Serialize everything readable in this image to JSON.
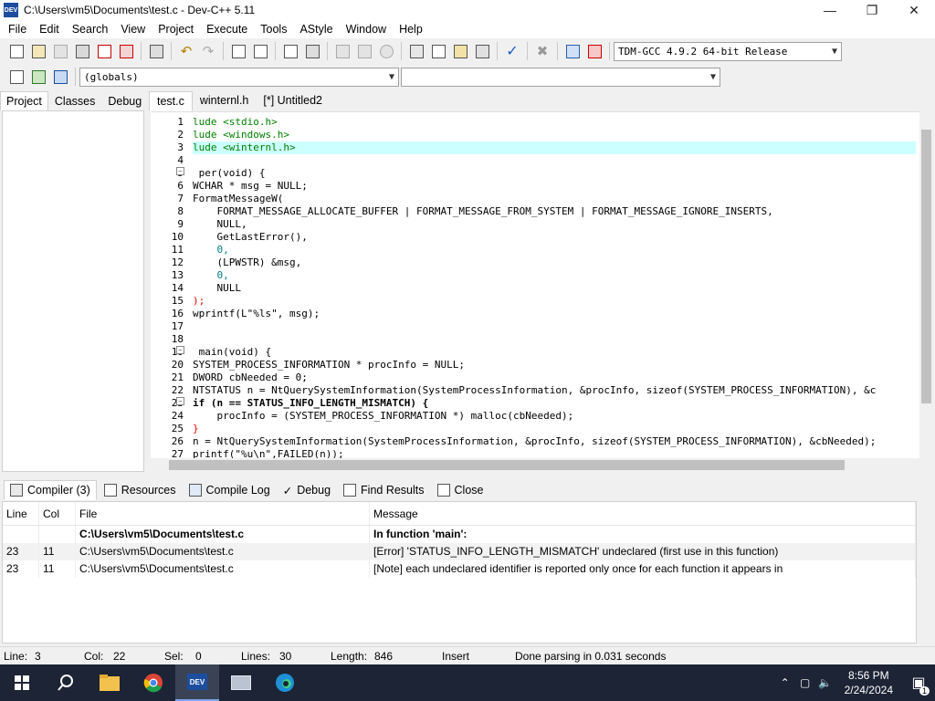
{
  "window": {
    "title": "C:\\Users\\vm5\\Documents\\test.c - Dev-C++ 5.11",
    "app_icon": "DEV"
  },
  "menu": [
    "File",
    "Edit",
    "Search",
    "View",
    "Project",
    "Execute",
    "Tools",
    "AStyle",
    "Window",
    "Help"
  ],
  "toolbar": {
    "compiler": "TDM-GCC 4.9.2 64-bit Release",
    "scope": "(globals)",
    "member": ""
  },
  "left_tabs": [
    "Project",
    "Classes",
    "Debug"
  ],
  "editor_tabs": [
    "test.c",
    "winternl.h",
    "[*] Untitled2"
  ],
  "code_lines": [
    {
      "n": "1",
      "t": "lude <stdio.h>"
    },
    {
      "n": "2",
      "t": "lude <windows.h>"
    },
    {
      "n": "3",
      "t": "lude <winternl.h>"
    },
    {
      "n": "4",
      "t": ""
    },
    {
      "n": "5",
      "t": " per(void) {"
    },
    {
      "n": "6",
      "t": "WCHAR * msg = NULL;"
    },
    {
      "n": "7",
      "t": "FormatMessageW("
    },
    {
      "n": "8",
      "t": "    FORMAT_MESSAGE_ALLOCATE_BUFFER | FORMAT_MESSAGE_FROM_SYSTEM | FORMAT_MESSAGE_IGNORE_INSERTS,"
    },
    {
      "n": "9",
      "t": "    NULL,"
    },
    {
      "n": "10",
      "t": "    GetLastError(),"
    },
    {
      "n": "11",
      "t": "    0,"
    },
    {
      "n": "12",
      "t": "    (LPWSTR) &msg,"
    },
    {
      "n": "13",
      "t": "    0,"
    },
    {
      "n": "14",
      "t": "    NULL"
    },
    {
      "n": "15",
      "t": ");"
    },
    {
      "n": "16",
      "t": "wprintf(L\"%ls\", msg);"
    },
    {
      "n": "17",
      "t": ""
    },
    {
      "n": "18",
      "t": ""
    },
    {
      "n": "19",
      "t": " main(void) {"
    },
    {
      "n": "20",
      "t": "SYSTEM_PROCESS_INFORMATION * procInfo = NULL;"
    },
    {
      "n": "21",
      "t": "DWORD cbNeeded = 0;"
    },
    {
      "n": "22",
      "t": "NTSTATUS n = NtQuerySystemInformation(SystemProcessInformation, &procInfo, sizeof(SYSTEM_PROCESS_INFORMATION), &c"
    },
    {
      "n": "23",
      "t": "if (n == STATUS_INFO_LENGTH_MISMATCH) {"
    },
    {
      "n": "24",
      "t": "    procInfo = (SYSTEM_PROCESS_INFORMATION *) malloc(cbNeeded);"
    },
    {
      "n": "25",
      "t": "}"
    },
    {
      "n": "26",
      "t": "n = NtQuerySystemInformation(SystemProcessInformation, &procInfo, sizeof(SYSTEM_PROCESS_INFORMATION), &cbNeeded);"
    },
    {
      "n": "27",
      "t": "printf(\"%u\\n\",FAILED(n));"
    }
  ],
  "bottom_tabs": [
    "Compiler (3)",
    "Resources",
    "Compile Log",
    "Debug",
    "Find Results",
    "Close"
  ],
  "messages": {
    "headers": [
      "Line",
      "Col",
      "File",
      "Message"
    ],
    "rows": [
      {
        "line": "",
        "col": "",
        "file": "C:\\Users\\vm5\\Documents\\test.c",
        "msg": "In function 'main':",
        "bold": true
      },
      {
        "line": "23",
        "col": "11",
        "file": "C:\\Users\\vm5\\Documents\\test.c",
        "msg": "[Error] 'STATUS_INFO_LENGTH_MISMATCH' undeclared (first use in this function)",
        "sel": true
      },
      {
        "line": "23",
        "col": "11",
        "file": "C:\\Users\\vm5\\Documents\\test.c",
        "msg": "[Note] each undeclared identifier is reported only once for each function it appears in"
      }
    ]
  },
  "status": {
    "line_label": "Line:",
    "line": "3",
    "col_label": "Col:",
    "col": "22",
    "sel_label": "Sel:",
    "sel": "0",
    "lines_label": "Lines:",
    "lines": "30",
    "length_label": "Length:",
    "length": "846",
    "mode": "Insert",
    "message": "Done parsing in 0.031 seconds"
  },
  "taskbar": {
    "time": "8:56 PM",
    "date": "2/24/2024",
    "notifications": "1"
  }
}
